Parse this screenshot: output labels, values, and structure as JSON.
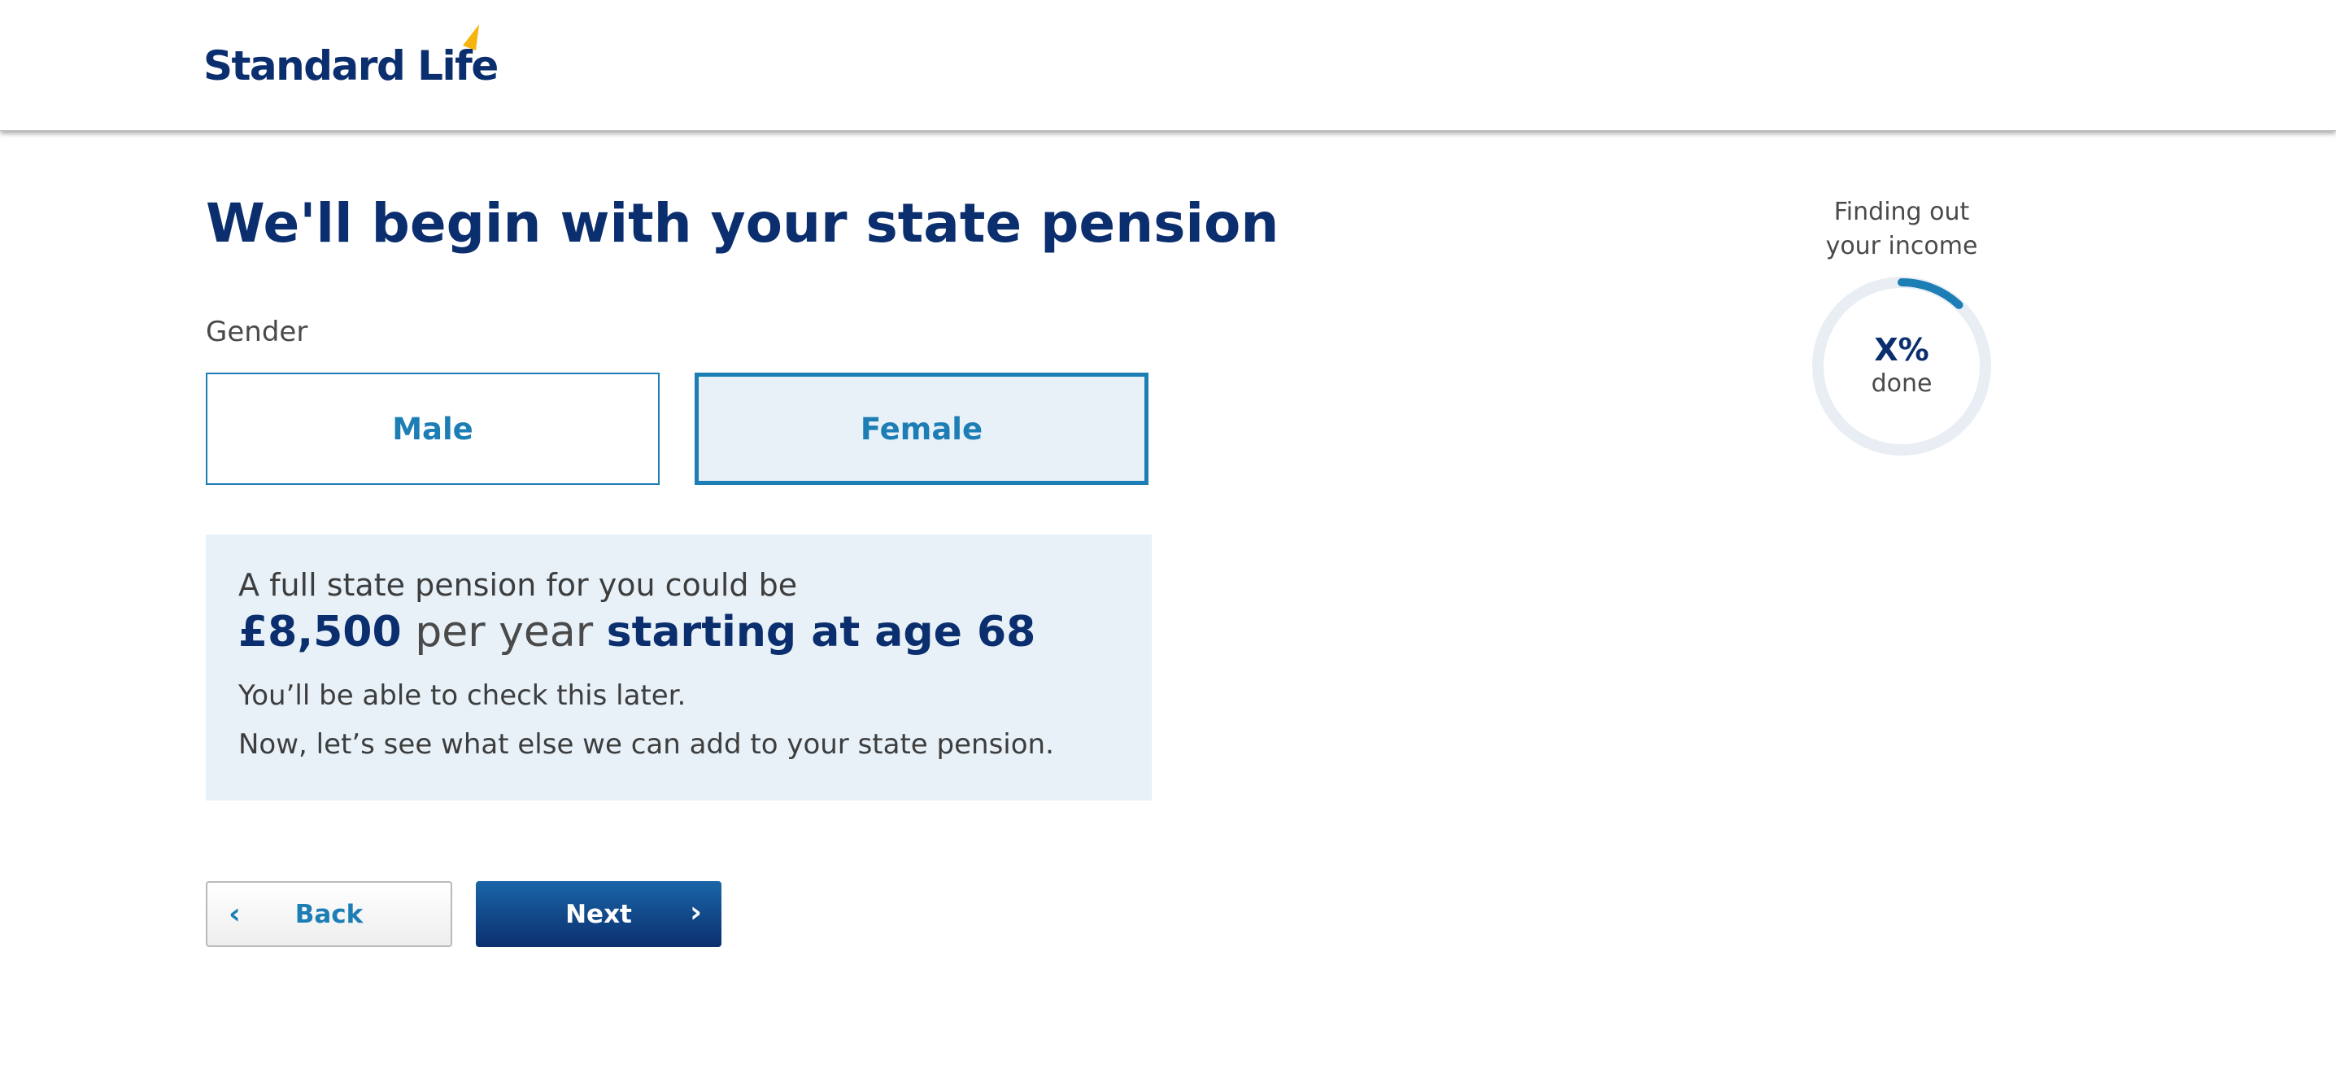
{
  "header": {
    "logo_text": "Standard Life",
    "logo_tick_color": "#f6b40e",
    "brand_color": "#0b2f6e"
  },
  "main": {
    "title": "We'll begin with your state pension",
    "gender_label": "Gender",
    "options": [
      {
        "label": "Male",
        "selected": false
      },
      {
        "label": "Female",
        "selected": true
      }
    ],
    "info": {
      "line1": "A full state pension for you could be",
      "amount": "£8,500",
      "per": "per year",
      "starting": "starting at age 68",
      "note1": "You’ll be able to check this later.",
      "note2": "Now, let’s see what else we can add to your state pension."
    }
  },
  "nav": {
    "back_label": "Back",
    "back_icon": "chevron-left-icon",
    "next_label": "Next",
    "next_icon": "chevron-right-icon"
  },
  "progress": {
    "caption_line1": "Finding out",
    "caption_line2": "your income",
    "percent_text": "X%",
    "done_text": "done",
    "fill_fraction": 0.12,
    "accent_color": "#1d7db5",
    "track_color": "#e9eef5"
  }
}
